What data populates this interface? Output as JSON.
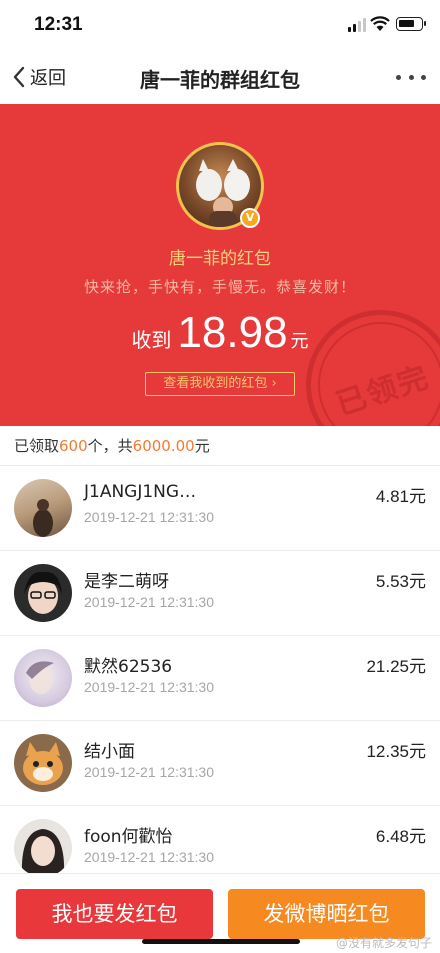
{
  "status_bar": {
    "time": "12:31"
  },
  "nav": {
    "back_label": "返回",
    "title": "唐一菲的群组红包",
    "more_icon": "more-horizontal-icon"
  },
  "header": {
    "sender_name": "唐一菲的红包",
    "blessing": "快来抢，手快有，手慢无。恭喜发财！",
    "received_prefix": "收到",
    "received_amount": "18.98",
    "received_unit": "元",
    "view_received_label": "查看我收到的红包 ›",
    "stamp_text": "已领完",
    "verified_badge": "V",
    "accent_color": "#e6393a"
  },
  "summary": {
    "prefix": "已领取",
    "count": "600",
    "mid": "个，共",
    "total": "6000.00",
    "suffix": "元"
  },
  "records": [
    {
      "name": "J1ANGJ1NG…",
      "time": "2019-12-21 12:31:30",
      "amount": "4.81元"
    },
    {
      "name": "是李二萌呀",
      "time": "2019-12-21 12:31:30",
      "amount": "5.53元"
    },
    {
      "name": "默然62536",
      "time": "2019-12-21 12:31:30",
      "amount": "21.25元"
    },
    {
      "name": "结小面",
      "time": "2019-12-21 12:31:30",
      "amount": "12.35元"
    },
    {
      "name": "foon何歡怡",
      "time": "2019-12-21 12:31:30",
      "amount": "6.48元"
    }
  ],
  "actions": {
    "send_label": "我也要发红包",
    "share_label": "发微博晒红包"
  },
  "watermark": "@没有就多发句子"
}
